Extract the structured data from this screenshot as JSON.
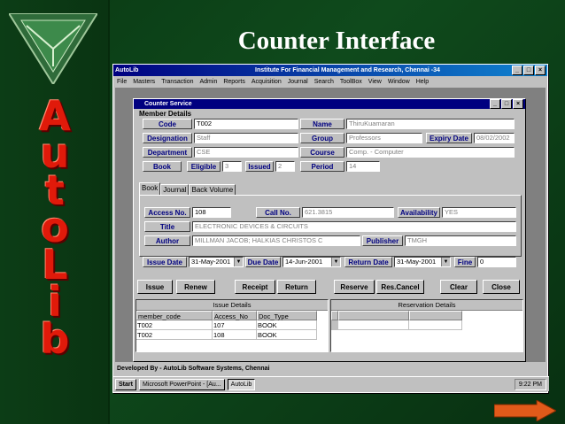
{
  "slide_title": "Counter Interface",
  "logo_letters": [
    "A",
    "u",
    "t",
    "o",
    "L",
    "i",
    "b"
  ],
  "app": {
    "title": "AutoLib",
    "center_title": "Institute For Financial Management and Research, Chennai -34",
    "menus": [
      "File",
      "Masters",
      "Transaction",
      "Admin",
      "Reports",
      "Acquisition",
      "Journal",
      "Search",
      "ToolBox",
      "View",
      "Window",
      "Help"
    ],
    "status": "Developed By -  AutoLib Software Systems, Chennai"
  },
  "form": {
    "title": "Counter Service",
    "group_label": "Member Details",
    "code_label": "Code",
    "code_value": "T002",
    "name_label": "Name",
    "name_value": "ThiruKuamaran",
    "designation_label": "Designation",
    "designation_value": "Staff",
    "group_field_label": "Group",
    "group_value": "Professors",
    "expiry_label": "Expiry Date",
    "expiry_value": "08/02/2002",
    "department_label": "Department",
    "department_value": "CSE",
    "course_label": "Course",
    "course_value": "Comp. - Computer",
    "book_label": "Book",
    "eligible_label": "Eligible",
    "eligible_value": "3",
    "issued_label": "Issued",
    "issued_value": "2",
    "period_label": "Period",
    "period_value": "14",
    "tabs": [
      "Book",
      "Journal",
      "Back Volume"
    ],
    "access_label": "Access No.",
    "access_value": "108",
    "callno_label": "Call No.",
    "callno_value": "621.3815",
    "availability_label": "Availability",
    "availability_value": "YES",
    "title_label": "Title",
    "title_value": "ELECTRONIC DEVICES & CIRCUITS",
    "author_label": "Author",
    "author_value": "MILLMAN JACOB; HALKIAS CHRISTOS C",
    "publisher_label": "Publisher",
    "publisher_value": "TMGH",
    "issue_date_label": "Issue Date",
    "issue_date_value": "31-May-2001",
    "due_date_label": "Due Date",
    "due_date_value": "14-Jun-2001",
    "return_date_label": "Return Date",
    "return_date_value": "31-May-2001",
    "fine_label": "Fine",
    "fine_value": "0"
  },
  "buttons": [
    "Issue",
    "Renew",
    "Receipt",
    "Return",
    "Reserve",
    "Res.Cancel",
    "Clear",
    "Close"
  ],
  "issue_details": {
    "title": "Issue Details",
    "columns": [
      "member_code",
      "Access_No",
      "Doc_Type"
    ],
    "rows": [
      [
        "T002",
        "107",
        "BOOK"
      ],
      [
        "T002",
        "108",
        "BOOK"
      ]
    ]
  },
  "reservation_details": {
    "title": "Reservation Details"
  },
  "taskbar": {
    "start": "Start",
    "items": [
      "Microsoft PowerPoint - [Au...",
      "AutoLib"
    ],
    "clock": "9:22 PM"
  }
}
